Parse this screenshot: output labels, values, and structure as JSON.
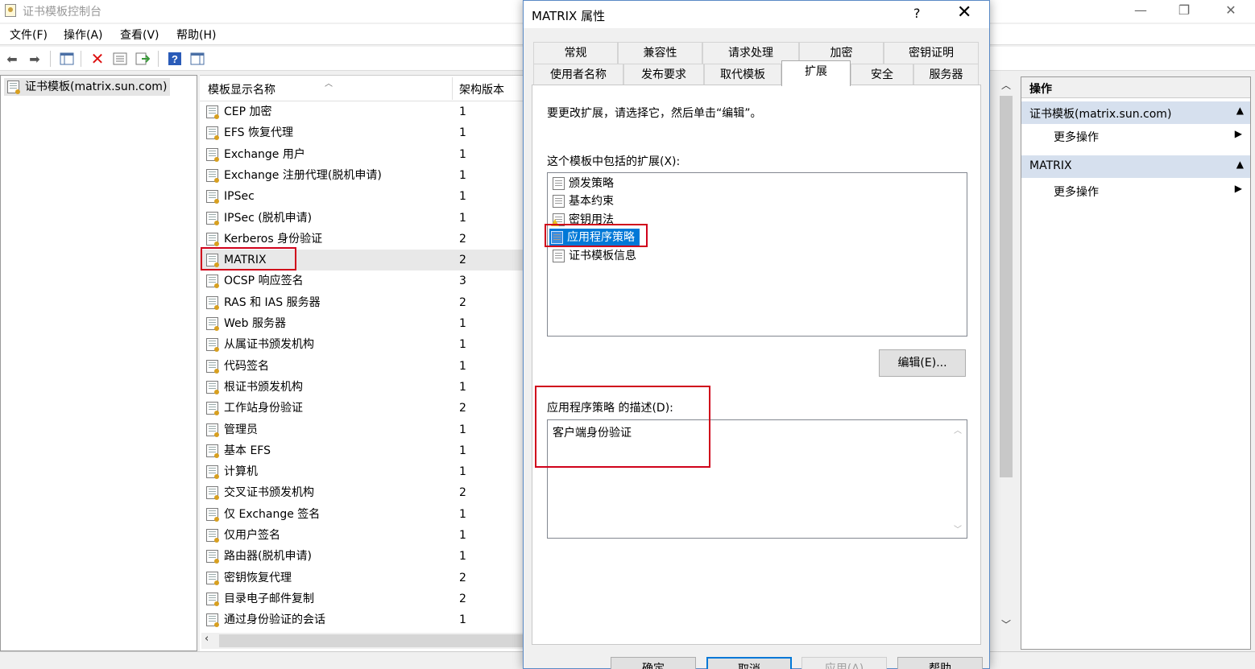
{
  "window": {
    "title": "证书模板控制台",
    "minimize_glyph": "—",
    "maximize_glyph": "❐",
    "close_glyph": "✕"
  },
  "menu": [
    "文件(F)",
    "操作(A)",
    "查看(V)",
    "帮助(H)"
  ],
  "toolbar_icons": [
    "back-arrow-icon",
    "forward-arrow-icon",
    "show-hide-tree-icon",
    "delete-icon",
    "properties-icon",
    "export-icon",
    "help-icon",
    "show-hide-action-pane-icon"
  ],
  "tree": {
    "root_label": "证书模板(matrix.sun.com)"
  },
  "list": {
    "columns": [
      "模板显示名称",
      "架构版本"
    ],
    "rows": [
      {
        "name": "CEP 加密",
        "version": "1"
      },
      {
        "name": "EFS 恢复代理",
        "version": "1"
      },
      {
        "name": "Exchange 用户",
        "version": "1"
      },
      {
        "name": "Exchange 注册代理(脱机申请)",
        "version": "1"
      },
      {
        "name": "IPSec",
        "version": "1"
      },
      {
        "name": "IPSec (脱机申请)",
        "version": "1"
      },
      {
        "name": "Kerberos 身份验证",
        "version": "2"
      },
      {
        "name": "MATRIX",
        "version": "2"
      },
      {
        "name": "OCSP 响应签名",
        "version": "3"
      },
      {
        "name": "RAS 和 IAS 服务器",
        "version": "2"
      },
      {
        "name": "Web 服务器",
        "version": "1"
      },
      {
        "name": "从属证书颁发机构",
        "version": "1"
      },
      {
        "name": "代码签名",
        "version": "1"
      },
      {
        "name": "根证书颁发机构",
        "version": "1"
      },
      {
        "name": "工作站身份验证",
        "version": "2"
      },
      {
        "name": "管理员",
        "version": "1"
      },
      {
        "name": "基本 EFS",
        "version": "1"
      },
      {
        "name": "计算机",
        "version": "1"
      },
      {
        "name": "交叉证书颁发机构",
        "version": "2"
      },
      {
        "name": "仅 Exchange 签名",
        "version": "1"
      },
      {
        "name": "仅用户签名",
        "version": "1"
      },
      {
        "name": "路由器(脱机申请)",
        "version": "1"
      },
      {
        "name": "密钥恢复代理",
        "version": "2"
      },
      {
        "name": "目录电子邮件复制",
        "version": "2"
      },
      {
        "name": "通过身份验证的会话",
        "version": "1"
      }
    ]
  },
  "actions": {
    "title": "操作",
    "sections": [
      {
        "header": "证书模板(matrix.sun.com)",
        "item": "更多操作"
      },
      {
        "header": "MATRIX",
        "item": "更多操作"
      }
    ]
  },
  "dialog": {
    "title": "MATRIX 属性",
    "help_glyph": "?",
    "close_glyph": "✕",
    "tabs_row1": [
      "常规",
      "兼容性",
      "请求处理",
      "加密",
      "密钥证明"
    ],
    "tabs_row2": [
      "使用者名称",
      "发布要求",
      "取代模板",
      "扩展",
      "安全",
      "服务器"
    ],
    "active_tab": "扩展",
    "instruction": "要更改扩展，请选择它，然后单击“编辑”。",
    "extensions_label": "这个模板中包括的扩展(X):",
    "extensions": [
      "颁发策略",
      "基本约束",
      "密钥用法",
      "应用程序策略",
      "证书模板信息"
    ],
    "selected_extension": "应用程序策略",
    "edit_button": "编辑(E)...",
    "description_label": "应用程序策略 的描述(D):",
    "description_text": "客户端身份验证",
    "buttons": [
      "确定",
      "取消",
      "应用(A)",
      "帮助"
    ]
  },
  "colors": {
    "selection": "#0078d7",
    "highlight_box": "#d0021b",
    "action_header": "#d6e0ee"
  }
}
